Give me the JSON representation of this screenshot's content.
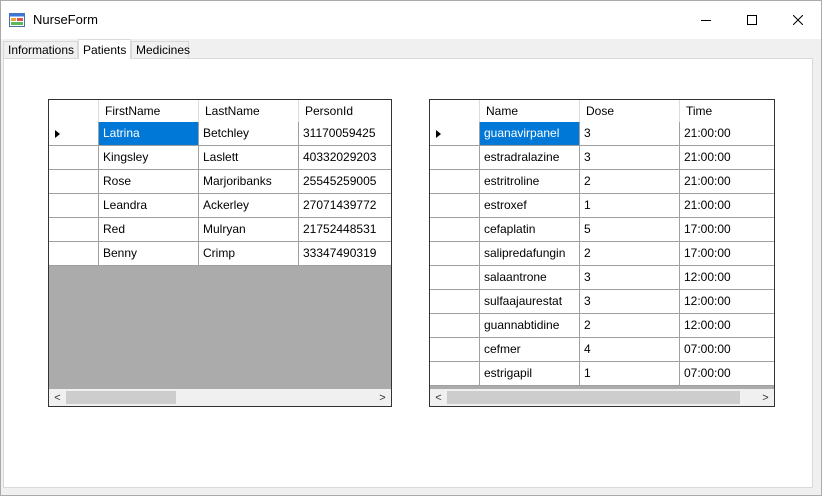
{
  "window": {
    "title": "NurseForm",
    "minimize_glyph": "—",
    "maximize_glyph": "☐",
    "close_glyph": "✕",
    "icon": "form-app-icon"
  },
  "tabs": [
    {
      "label": "Informations",
      "active": false
    },
    {
      "label": "Patients",
      "active": true
    },
    {
      "label": "Medicines",
      "active": false
    }
  ],
  "patients_grid": {
    "columns": [
      "FirstName",
      "LastName",
      "PersonId"
    ],
    "rows": [
      {
        "first": "Latrina",
        "last": "Betchley",
        "id": "31170059425"
      },
      {
        "first": "Kingsley",
        "last": "Laslett",
        "id": "40332029203"
      },
      {
        "first": "Rose",
        "last": "Marjoribanks",
        "id": "25545259005"
      },
      {
        "first": "Leandra",
        "last": "Ackerley",
        "id": "27071439772"
      },
      {
        "first": "Red",
        "last": "Mulryan",
        "id": "21752448531"
      },
      {
        "first": "Benny",
        "last": "Crimp",
        "id": "33347490319"
      }
    ],
    "selected_row": 0,
    "scroll_left_glyph": "<",
    "scroll_right_glyph": ">"
  },
  "medicines_grid": {
    "columns": [
      "Name",
      "Dose",
      "Time"
    ],
    "rows": [
      {
        "name": "guanavirpanel",
        "dose": "3",
        "time": "21:00:00"
      },
      {
        "name": "estradralazine",
        "dose": "3",
        "time": "21:00:00"
      },
      {
        "name": "estritroline",
        "dose": "2",
        "time": "21:00:00"
      },
      {
        "name": "estroxef",
        "dose": "1",
        "time": "21:00:00"
      },
      {
        "name": "cefaplatin",
        "dose": "5",
        "time": "17:00:00"
      },
      {
        "name": "salipredafungin",
        "dose": "2",
        "time": "17:00:00"
      },
      {
        "name": "salaantrone",
        "dose": "3",
        "time": "12:00:00"
      },
      {
        "name": "sulfaajaurestat",
        "dose": "3",
        "time": "12:00:00"
      },
      {
        "name": "guannabtidine",
        "dose": "2",
        "time": "12:00:00"
      },
      {
        "name": "cefmer",
        "dose": "4",
        "time": "07:00:00"
      },
      {
        "name": "estrigapil",
        "dose": "1",
        "time": "07:00:00"
      }
    ],
    "selected_row": 0,
    "scroll_left_glyph": "<",
    "scroll_right_glyph": ">"
  },
  "colors": {
    "selection": "#0078d7",
    "grid_background": "#ababab"
  }
}
